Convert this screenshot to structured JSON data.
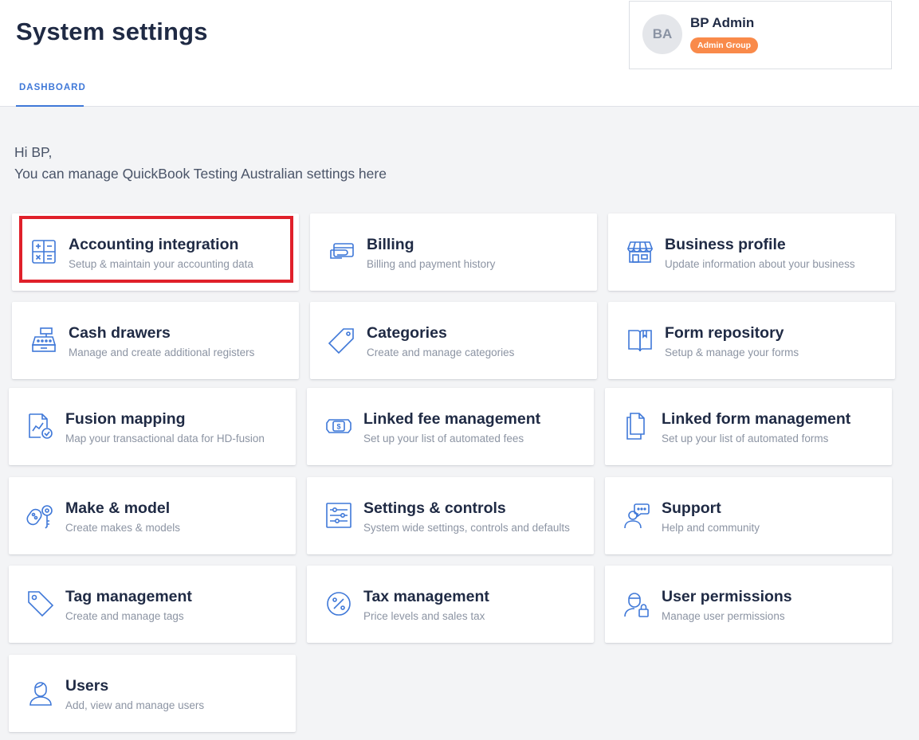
{
  "header": {
    "title": "System settings",
    "tabs": [
      {
        "label": "DASHBOARD",
        "active": true
      }
    ]
  },
  "user": {
    "initials": "BA",
    "name": "BP Admin",
    "group": "Admin Group"
  },
  "greeting": {
    "line1": "Hi BP,",
    "line2": "You can manage QuickBook Testing Australian settings here"
  },
  "colors": {
    "accent": "#3f78d8",
    "badge": "#f98a4a",
    "highlight": "#e0202a"
  },
  "cards": [
    {
      "title": "Accounting integration",
      "subtitle": "Setup & maintain your accounting data",
      "icon": "calculator-icon",
      "highlighted": true
    },
    {
      "title": "Billing",
      "subtitle": "Billing and payment history",
      "icon": "credit-card-icon"
    },
    {
      "title": "Business profile",
      "subtitle": "Update information about your business",
      "icon": "storefront-icon"
    },
    {
      "title": "Cash drawers",
      "subtitle": "Manage and create additional registers",
      "icon": "cash-register-icon"
    },
    {
      "title": "Categories",
      "subtitle": "Create and manage categories",
      "icon": "tag-outline-icon"
    },
    {
      "title": "Form repository",
      "subtitle": "Setup & manage your forms",
      "icon": "book-icon"
    },
    {
      "title": "Fusion mapping",
      "subtitle": "Map your transactional data for HD-fusion",
      "icon": "chart-document-icon"
    },
    {
      "title": "Linked fee management",
      "subtitle": "Set up your list of automated fees",
      "icon": "money-icon"
    },
    {
      "title": "Linked form management",
      "subtitle": "Set up your list of automated forms",
      "icon": "documents-icon"
    },
    {
      "title": "Make & model",
      "subtitle": "Create makes & models",
      "icon": "car-key-icon"
    },
    {
      "title": "Settings & controls",
      "subtitle": "System wide settings, controls and defaults",
      "icon": "sliders-icon"
    },
    {
      "title": "Support",
      "subtitle": "Help and community",
      "icon": "support-chat-icon"
    },
    {
      "title": "Tag management",
      "subtitle": "Create and manage tags",
      "icon": "tag-icon"
    },
    {
      "title": "Tax management",
      "subtitle": "Price levels and sales tax",
      "icon": "percent-icon"
    },
    {
      "title": "User permissions",
      "subtitle": "Manage user permissions",
      "icon": "user-lock-icon"
    },
    {
      "title": "Users",
      "subtitle": "Add, view and manage users",
      "icon": "user-icon"
    }
  ]
}
